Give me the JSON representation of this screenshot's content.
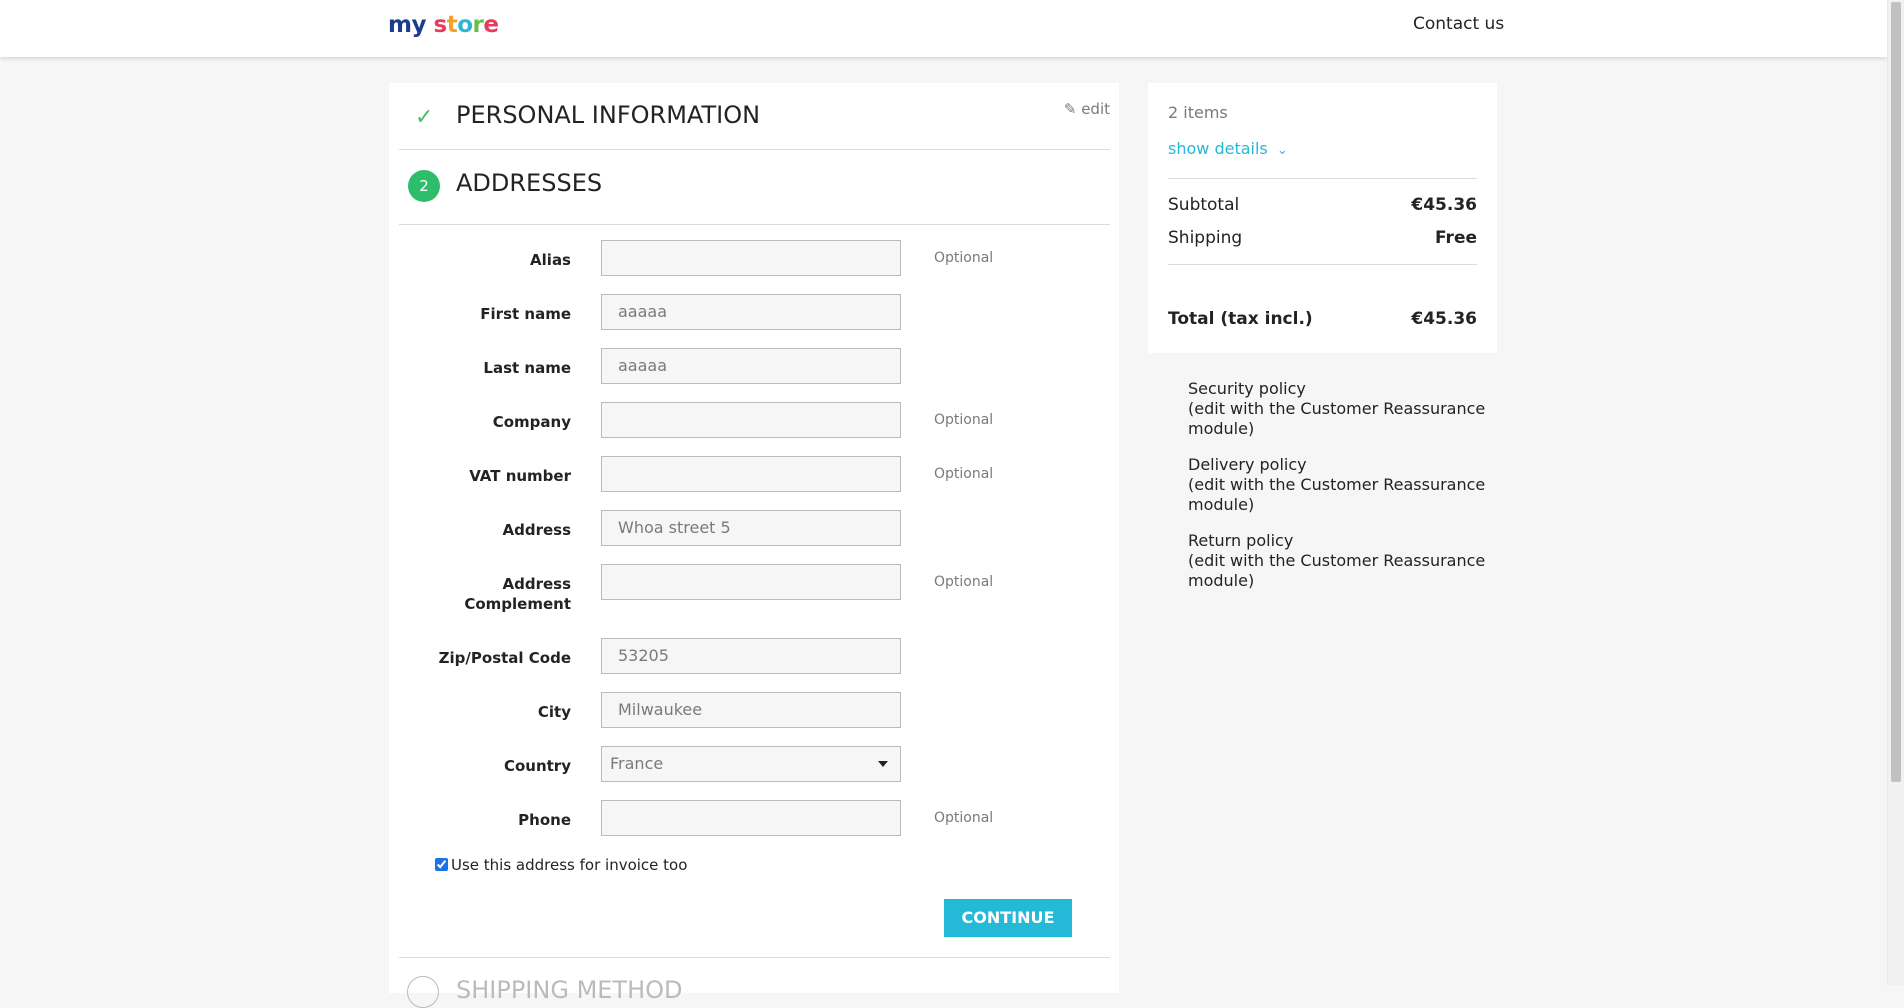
{
  "header": {
    "logo": {
      "part1": "my",
      "part2_a": "s",
      "part2_b": "t",
      "part2_c": "o",
      "part2_d": "r",
      "part2_e": "e"
    },
    "contact_label": "Contact us"
  },
  "steps": {
    "personal": {
      "title": "PERSONAL INFORMATION",
      "edit_label": "edit"
    },
    "addresses": {
      "number": "2",
      "title": "ADDRESSES"
    },
    "shipping": {
      "title": "SHIPPING METHOD"
    }
  },
  "form": {
    "optional_label": "Optional",
    "fields": {
      "alias": {
        "label": "Alias",
        "value": ""
      },
      "firstname": {
        "label": "First name",
        "value": "aaaaa"
      },
      "lastname": {
        "label": "Last name",
        "value": "aaaaa"
      },
      "company": {
        "label": "Company",
        "value": ""
      },
      "vat": {
        "label": "VAT number",
        "value": ""
      },
      "address": {
        "label": "Address",
        "value": "Whoa street 5"
      },
      "address2": {
        "label_line1": "Address",
        "label_line2": "Complement",
        "value": ""
      },
      "zip": {
        "label": "Zip/Postal Code",
        "value": "53205"
      },
      "city": {
        "label": "City",
        "value": "Milwaukee"
      },
      "country": {
        "label": "Country",
        "value": "France"
      },
      "phone": {
        "label": "Phone",
        "value": ""
      }
    },
    "invoice_checkbox_label": "Use this address for invoice too",
    "continue_label": "CONTINUE"
  },
  "summary": {
    "items_count": "2 items",
    "show_details": "show details",
    "subtotal_label": "Subtotal",
    "subtotal_value": "€45.36",
    "shipping_label": "Shipping",
    "shipping_value": "Free",
    "total_label": "Total (tax incl.)",
    "total_value": "€45.36"
  },
  "reassurance": [
    {
      "title": "Security policy",
      "note": "(edit with the Customer Reassurance module)"
    },
    {
      "title": "Delivery policy",
      "note": "(edit with the Customer Reassurance module)"
    },
    {
      "title": "Return policy",
      "note": "(edit with the Customer Reassurance module)"
    }
  ]
}
